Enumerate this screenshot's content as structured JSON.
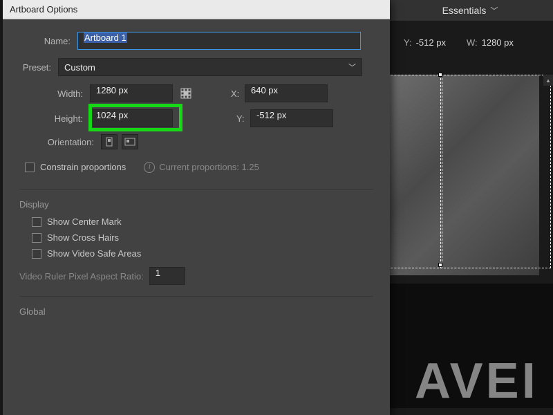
{
  "workspace": {
    "label": "Essentials"
  },
  "topCoords": {
    "yLabel": "Y:",
    "yValue": "-512 px",
    "wLabel": "W:",
    "wValue": "1280 px"
  },
  "dialog": {
    "title": "Artboard Options",
    "nameLabel": "Name:",
    "nameValue": "Artboard 1",
    "presetLabel": "Preset:",
    "presetValue": "Custom",
    "widthLabel": "Width:",
    "widthValue": "1280 px",
    "heightLabel": "Height:",
    "heightValue": "1024 px",
    "xLabel": "X:",
    "xValue": "640 px",
    "yLabel": "Y:",
    "yValue": "-512 px",
    "orientationLabel": "Orientation:",
    "constrainLabel": "Constrain proportions",
    "currentProportions": "Current proportions: 1.25",
    "displayHead": "Display",
    "showCenter": "Show Center Mark",
    "showCross": "Show Cross Hairs",
    "showSafe": "Show Video Safe Areas",
    "ratioLabel": "Video Ruler Pixel Aspect Ratio:",
    "ratioValue": "1",
    "globalHead": "Global"
  },
  "canvas": {
    "bigText": "AVEI"
  }
}
